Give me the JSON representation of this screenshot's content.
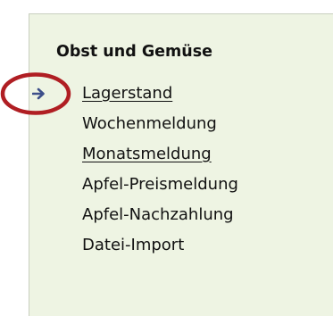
{
  "menu": {
    "title": "Obst und Gemüse",
    "items": [
      {
        "label": "Lagerstand",
        "active": true,
        "underlined": true
      },
      {
        "label": "Wochenmeldung",
        "active": false,
        "underlined": false
      },
      {
        "label": "Monatsmeldung",
        "active": false,
        "underlined": true
      },
      {
        "label": "Apfel-Preismeldung",
        "active": false,
        "underlined": false
      },
      {
        "label": "Apfel-Nachzahlung",
        "active": false,
        "underlined": false
      },
      {
        "label": "Datei-Import",
        "active": false,
        "underlined": false
      }
    ]
  },
  "colors": {
    "panel_background": "#eef4e3",
    "arrow": "#3d4f8a",
    "highlight_circle": "#b01e23",
    "text": "#111111"
  },
  "icons": {
    "active_marker": "arrow-right-icon",
    "annotation": "highlight-circle"
  }
}
